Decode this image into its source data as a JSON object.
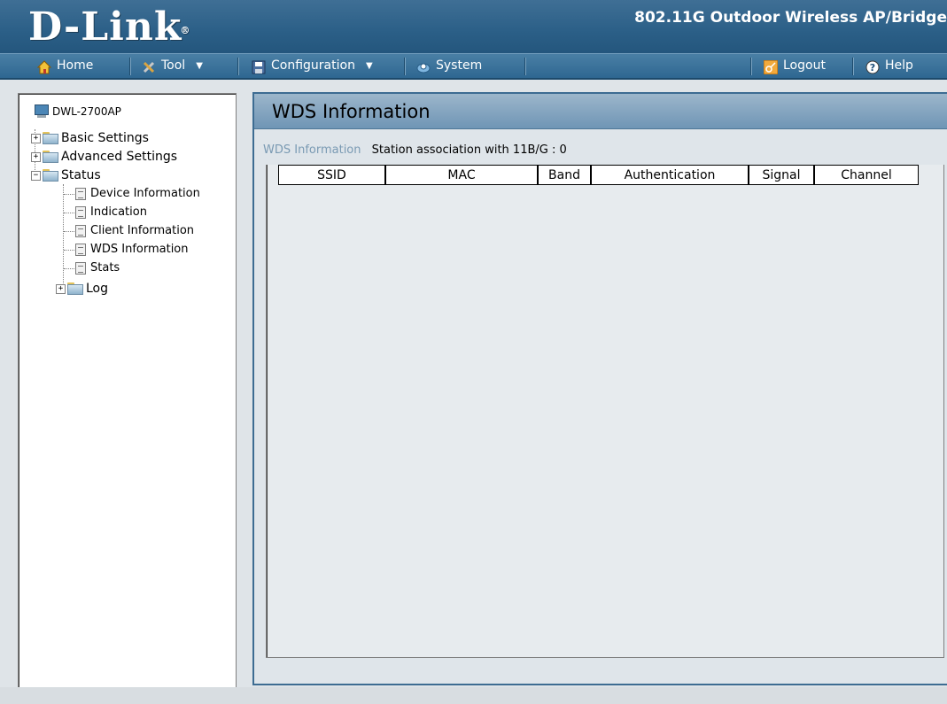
{
  "header": {
    "logo_text": "D-Link",
    "logo_reg": "®",
    "product_title": "802.11G Outdoor Wireless AP/Bridge"
  },
  "menubar": {
    "home": "Home",
    "tool": "Tool",
    "configuration": "Configuration",
    "system": "System",
    "logout": "Logout",
    "help": "Help"
  },
  "tree": {
    "root": "DWL-2700AP",
    "basic_settings": "Basic Settings",
    "advanced_settings": "Advanced Settings",
    "status": "Status",
    "children": [
      "Device Information",
      "Indication",
      "Client Information",
      "WDS Information",
      "Stats"
    ],
    "log": "Log"
  },
  "panel": {
    "title": "WDS Information",
    "section_label": "WDS Information",
    "association_text": "Station association with 11B/G : 0",
    "columns": [
      "SSID",
      "MAC",
      "Band",
      "Authentication",
      "Signal",
      "Channel"
    ]
  },
  "colors": {
    "header_bg": "#2b5f87",
    "panel_title_bg": "#8aa8c1",
    "section_label": "#7a9ab3"
  }
}
